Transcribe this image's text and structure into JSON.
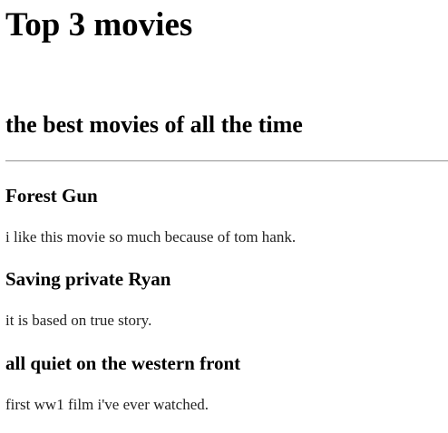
{
  "header": {
    "title": "Top 3 movies",
    "subtitle": "the best movies of all the time"
  },
  "movies": [
    {
      "title": "Forest Gun",
      "description": "i like this movie so much because of tom hank."
    },
    {
      "title": "Saving private Ryan",
      "description": "it is based on true story."
    },
    {
      "title": "all quiet on the western front",
      "description": "first ww1 film i've ever watched."
    }
  ]
}
